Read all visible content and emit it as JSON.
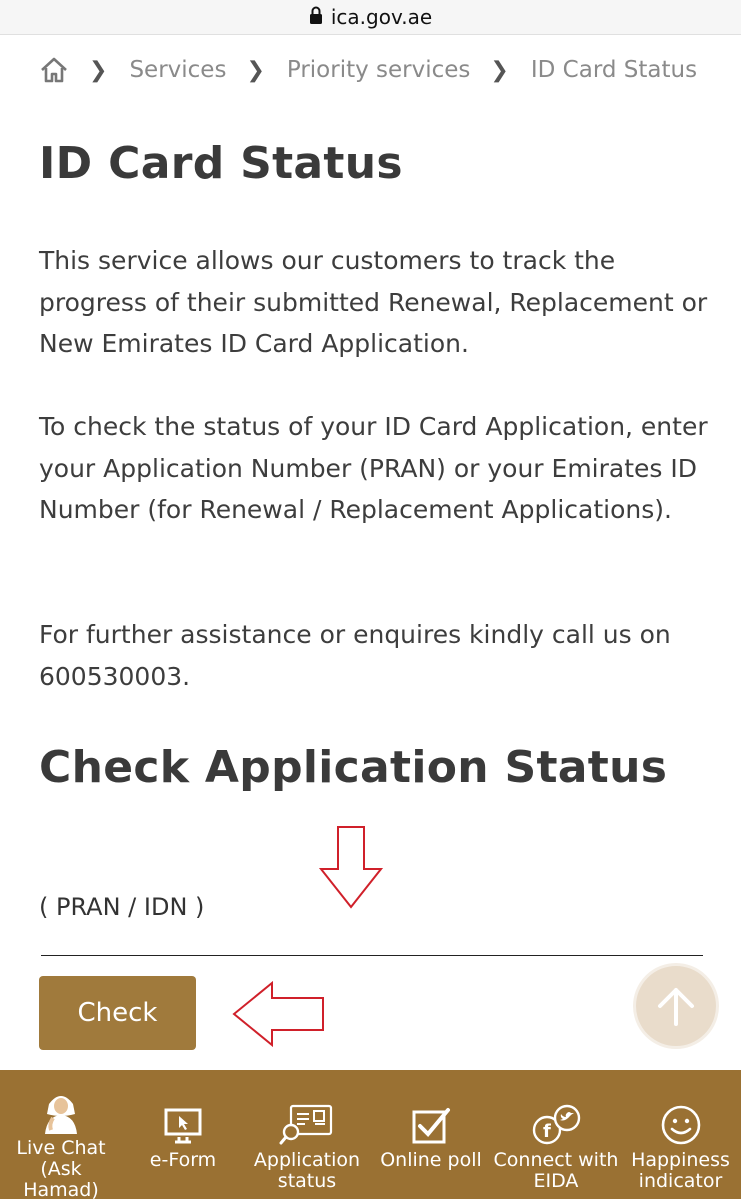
{
  "browser": {
    "url": "ica.gov.ae"
  },
  "breadcrumb": {
    "items": [
      "Services",
      "Priority services",
      "ID Card Status"
    ]
  },
  "page": {
    "title": "ID Card Status",
    "paragraphs": [
      "This service allows our customers to track the progress of their submitted Renewal, Replacement or New Emirates ID Card Application.",
      "To check the status of your ID Card Application, enter your Application Number (PRAN) or your Emirates ID Number (for Renewal / Replacement Applications).",
      "For further assistance or enquires kindly call us on 600530003."
    ]
  },
  "form": {
    "section_title": "Check Application Status",
    "field_label": "( PRAN / IDN )",
    "field_value": "",
    "check_label": "Check"
  },
  "bottom_nav": {
    "items": [
      {
        "label": "Live Chat\n(Ask Hamad)",
        "icon": "assistant-avatar-icon"
      },
      {
        "label": "e-Form",
        "icon": "monitor-cursor-icon"
      },
      {
        "label": "Application\nstatus",
        "icon": "id-card-search-icon"
      },
      {
        "label": "Online poll",
        "icon": "checkbox-icon"
      },
      {
        "label": "Connect with\nEIDA",
        "icon": "social-media-icon"
      },
      {
        "label": "Happiness\nindicator",
        "icon": "smiley-icon"
      }
    ]
  },
  "colors": {
    "brand": "#9a7133",
    "button": "#a07a3c",
    "annotation_arrow": "#d0202a",
    "scroll_top_bg": "#e9dccb"
  }
}
